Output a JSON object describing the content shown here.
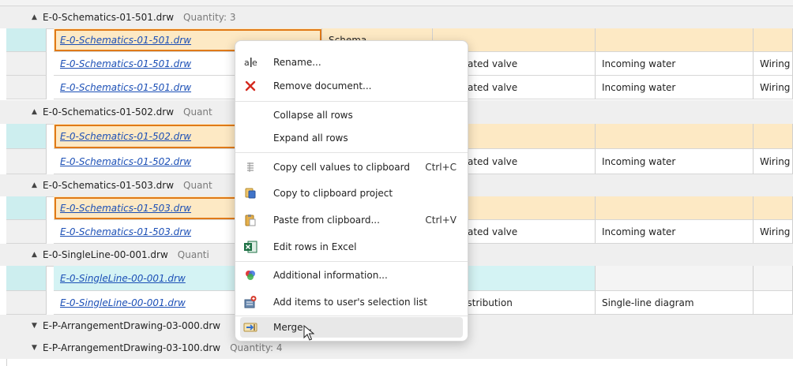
{
  "groups": [
    {
      "name": "E-0-Schematics-01-501.drw",
      "qty": "Quantity: 3"
    },
    {
      "name": "E-0-Schematics-01-502.drw",
      "qty": "Quant"
    },
    {
      "name": "E-0-Schematics-01-503.drw",
      "qty": "Quant"
    },
    {
      "name": "E-0-SingleLine-00-001.drw",
      "qty": "Quanti"
    },
    {
      "name": "E-P-ArrangementDrawing-03-000.drw",
      "qty": ""
    },
    {
      "name": "E-P-ArrangementDrawing-03-100.drw",
      "qty": "Quantity: 4"
    }
  ],
  "rows": {
    "g1r1": {
      "doc": "E-0-Schematics-01-501.drw",
      "c1": "Schema",
      "c2": "",
      "c3": "",
      "c4": ""
    },
    "g1r2": {
      "doc": "E-0-Schematics-01-501.drw",
      "c2": "r-operated valve",
      "c3": "Incoming water",
      "c4": "Wiring"
    },
    "g1r3": {
      "doc": "E-0-Schematics-01-501.drw",
      "c2": "r-operated valve",
      "c3": "Incoming water",
      "c4": "Wiring"
    },
    "g2r1": {
      "doc": "E-0-Schematics-01-502.drw"
    },
    "g2r2": {
      "doc": "E-0-Schematics-01-502.drw",
      "c2": "r-operated valve",
      "c3": "Incoming water",
      "c4": "Wiring"
    },
    "g3r1": {
      "doc": "E-0-Schematics-01-503.drw"
    },
    "g3r2": {
      "doc": "E-0-Schematics-01-503.drw",
      "c2": "r-operated valve",
      "c3": "Incoming water",
      "c4": "Wiring"
    },
    "g4r1": {
      "doc": "E-0-SingleLine-00-001.drw"
    },
    "g4r2": {
      "doc": "E-0-SingleLine-00-001.drw",
      "c2": "ical distribution",
      "c3": "Single-line diagram",
      "c4": ""
    }
  },
  "menu": {
    "rename": "Rename...",
    "remove": "Remove document...",
    "collapse": "Collapse all rows",
    "expand": "Expand all rows",
    "copy_cells": "Copy cell values to clipboard",
    "copy_cells_sc": "Ctrl+C",
    "copy_project": "Copy to clipboard project",
    "paste": "Paste from clipboard...",
    "paste_sc": "Ctrl+V",
    "excel": "Edit rows in Excel",
    "additional": "Additional information...",
    "add_items": "Add items to user's selection list",
    "merge": "Merge..."
  },
  "icons": {
    "rename": "rename-icon",
    "remove": "red-x-icon",
    "copy_cells": "copy-cells-icon",
    "copy_project": "copy-project-icon",
    "paste": "paste-icon",
    "excel": "excel-icon",
    "additional": "info-color-icon",
    "add_items": "add-to-list-icon",
    "merge": "merge-icon"
  },
  "colors": {
    "selection_outline": "#e07a18",
    "selected_row": "#fde9c4",
    "link": "#1b4fb6"
  }
}
